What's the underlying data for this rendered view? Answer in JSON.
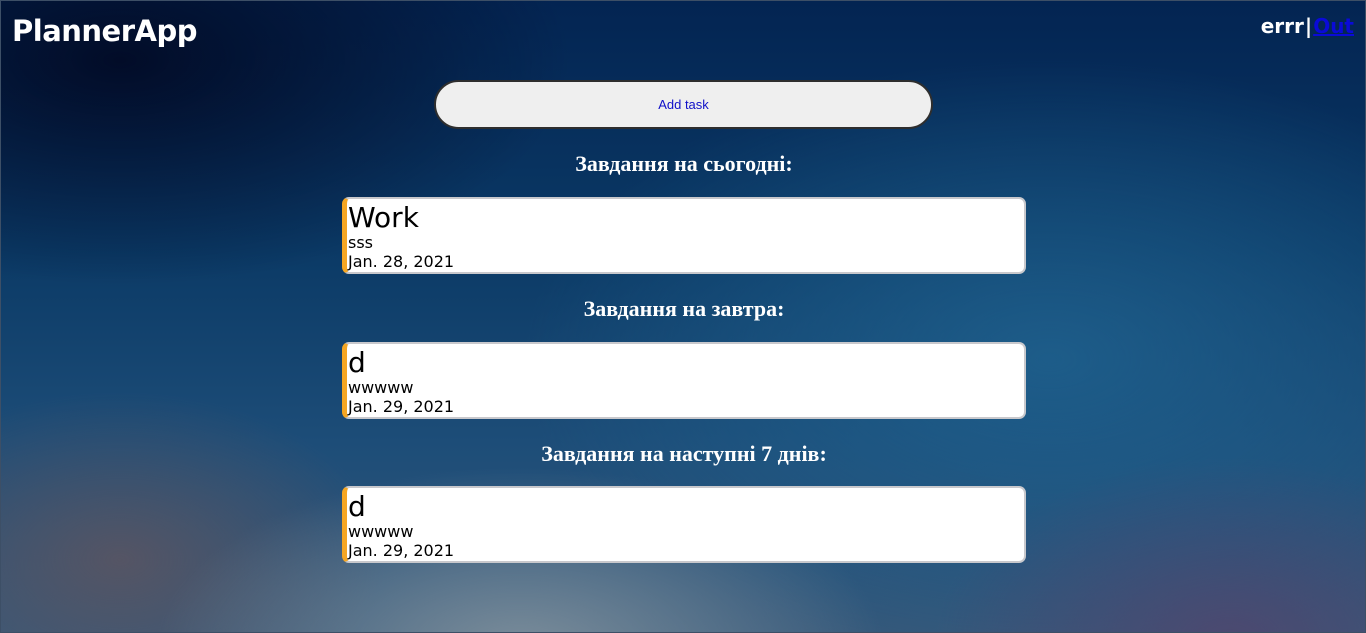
{
  "header": {
    "brand": "PlannerApp",
    "username": "errr",
    "separator": "|",
    "logout_label": "Out"
  },
  "add_task": {
    "label": "Add task"
  },
  "sections": [
    {
      "title": "Завдання на сьогодні:",
      "tasks": [
        {
          "title": "Work",
          "description": "sss",
          "date": "Jan. 28, 2021"
        }
      ]
    },
    {
      "title": "Завдання на завтра:",
      "tasks": [
        {
          "title": "d",
          "description": "wwwww",
          "date": "Jan. 29, 2021"
        }
      ]
    },
    {
      "title": "Завдання на наступні 7 днів:",
      "tasks": [
        {
          "title": "d",
          "description": "wwwww",
          "date": "Jan. 29, 2021"
        }
      ]
    }
  ],
  "colors": {
    "task_accent": "#f5a623",
    "link": "#0a0ad8"
  }
}
